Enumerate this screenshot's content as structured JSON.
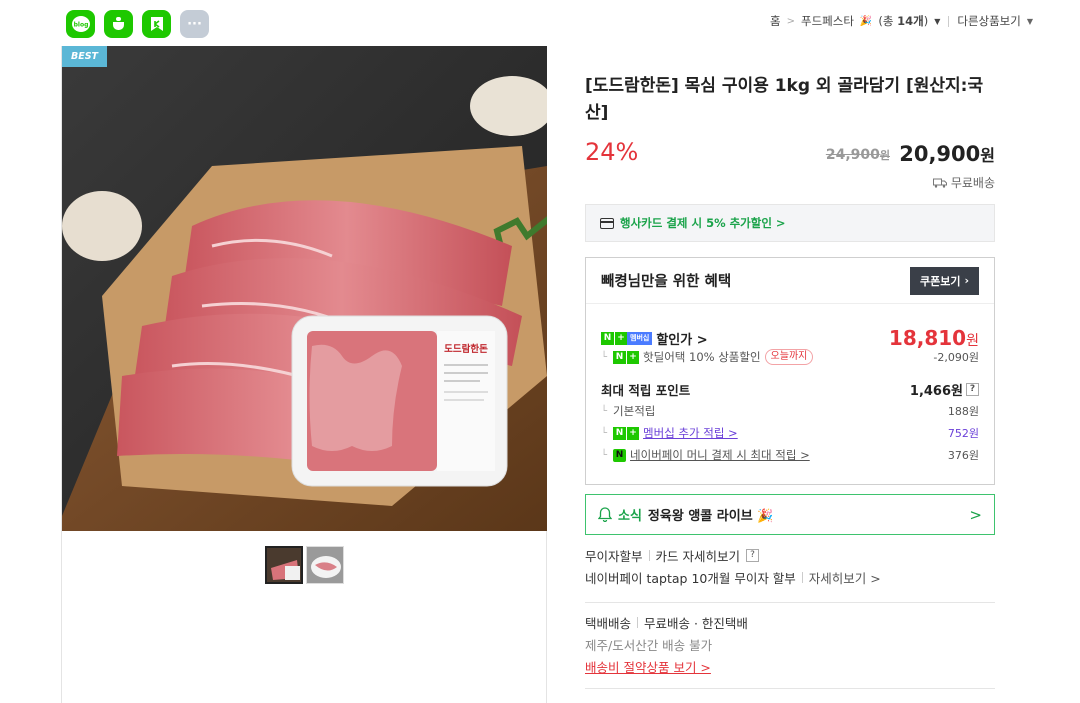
{
  "share": {
    "icons": [
      "blog-icon",
      "cafe-icon",
      "band-icon",
      "more-icon"
    ],
    "blog_label": "blog",
    "more_label": "···"
  },
  "breadcrumb": {
    "home": "홈",
    "store": "푸드페스타",
    "count_prefix": "(총 ",
    "count": "14개",
    "count_suffix": ")",
    "other": "다른상품보기"
  },
  "gallery": {
    "badge": "BEST",
    "package_brand": "도드람한돈"
  },
  "product": {
    "title": "[도드람한돈] 목심 구이용 1kg 외 골라담기 [원산지:국산]",
    "discount_rate": "24%",
    "original_price": "24,900",
    "original_unit": "원",
    "sale_price": "20,900",
    "sale_unit": "원",
    "shipping": "무료배송"
  },
  "card_promo": "행사카드 결제 시 5% 추가할인 >",
  "benefit": {
    "heading": "빼켱님만을 위한 혜택",
    "coupon_button": "쿠폰보기",
    "membership_badge": "멤버십",
    "discount_label": "할인가 >",
    "discount_price": "18,810",
    "discount_unit": "원",
    "hotdeal_label": "핫딜어택 10% 상품할인",
    "hotdeal_tag": "오늘까지",
    "hotdeal_amount": "-2,090원",
    "points_label": "최대 적립 포인트",
    "points_value": "1,466원",
    "points_help": "?",
    "base_label": "기본적립",
    "base_value": "188원",
    "member_label": "멤버십 추가 적립 >",
    "member_value": "752원",
    "npay_label": "네이버페이 머니 결제 시 최대 적립 >",
    "npay_value": "376원"
  },
  "news": {
    "tag": "소식",
    "text": "정육왕 앵콜 라이브 🎉",
    "arrow": ">"
  },
  "installment": {
    "label": "무이자할부",
    "card_detail": "카드 자세히보기",
    "help": "?",
    "npay_text": "네이버페이 taptap 10개월 무이자 할부",
    "detail_link": "자세히보기 >"
  },
  "delivery": {
    "method": "택배배송",
    "info": "무료배송 · 한진택배",
    "restriction": "제주/도서산간 배송 불가",
    "saving_link": "배송비 절약상품 보기 >"
  },
  "colors": {
    "naver_green": "#1ec800",
    "sale_red": "#e4343b",
    "accent_green": "#1aa34a",
    "best_blue": "#5bb7d6"
  }
}
